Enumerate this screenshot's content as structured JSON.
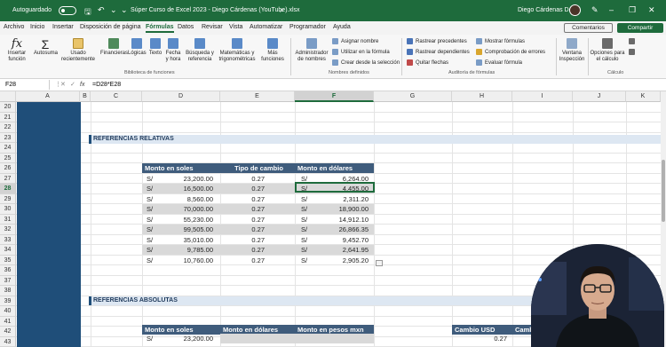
{
  "titlebar": {
    "autosave_label": "Autoguardado",
    "doc_title": "Súper Curso de Excel 2023 - Diego Cárdenas (YouTube).xlsx",
    "user_name": "Diego Cárdenas Dev"
  },
  "menu": {
    "items": [
      "Archivo",
      "Inicio",
      "Insertar",
      "Disposición de página",
      "Fórmulas",
      "Datos",
      "Revisar",
      "Vista",
      "Automatizar",
      "Programador",
      "Ayuda"
    ],
    "active": "Fórmulas",
    "comments_label": "Comentarios",
    "share_label": "Compartir"
  },
  "ribbon": {
    "insert_function": "Insertar función",
    "autosum": "Autosuma",
    "recent": "Usado recientemente",
    "financial": "Financieras",
    "logical": "Lógicas",
    "text": "Texto",
    "datetime": "Fecha y hora",
    "lookup": "Búsqueda y referencia",
    "math": "Matemáticas y trigonométricas",
    "more": "Más funciones",
    "group_library": "Biblioteca de funciones",
    "name_manager": "Administrador de nombres",
    "define_name": "Asignar nombre",
    "use_in_formula": "Utilizar en la fórmula",
    "create_from_selection": "Crear desde la selección",
    "group_names": "Nombres definidos",
    "trace_precedents": "Rastrear precedentes",
    "trace_dependents": "Rastrear dependientes",
    "remove_arrows": "Quitar flechas",
    "show_formulas": "Mostrar fórmulas",
    "error_checking": "Comprobación de errores",
    "evaluate_formula": "Evaluar fórmula",
    "group_auditing": "Auditoría de fórmulas",
    "watch_window": "Ventana Inspección",
    "calc_options": "Opciones para el cálculo",
    "group_calc": "Cálculo"
  },
  "formula_bar": {
    "name_box": "F28",
    "fx": "fx",
    "formula": "=D28*E28"
  },
  "columns": [
    "A",
    "B",
    "C",
    "D",
    "E",
    "F",
    "G",
    "H",
    "I",
    "J",
    "K"
  ],
  "rows": [
    "20",
    "21",
    "22",
    "23",
    "24",
    "25",
    "26",
    "27",
    "28",
    "29",
    "30",
    "31",
    "32",
    "33",
    "34",
    "35",
    "36",
    "37",
    "38",
    "39",
    "40",
    "41",
    "42",
    "43"
  ],
  "relativas": {
    "title": "REFERENCIAS RELATIVAS",
    "headers": [
      "Monto en soles",
      "Tipo de cambio",
      "Monto en dólares"
    ],
    "rows": [
      {
        "cur": "S/",
        "amount": "23,200.00",
        "rate": "0.27",
        "cur2": "S/",
        "usd": "6,264.00"
      },
      {
        "cur": "S/",
        "amount": "16,500.00",
        "rate": "0.27",
        "cur2": "S/",
        "usd": "4,455.00"
      },
      {
        "cur": "S/",
        "amount": "8,560.00",
        "rate": "0.27",
        "cur2": "S/",
        "usd": "2,311.20"
      },
      {
        "cur": "S/",
        "amount": "70,000.00",
        "rate": "0.27",
        "cur2": "S/",
        "usd": "18,900.00"
      },
      {
        "cur": "S/",
        "amount": "55,230.00",
        "rate": "0.27",
        "cur2": "S/",
        "usd": "14,912.10"
      },
      {
        "cur": "S/",
        "amount": "99,505.00",
        "rate": "0.27",
        "cur2": "S/",
        "usd": "26,866.35"
      },
      {
        "cur": "S/",
        "amount": "35,010.00",
        "rate": "0.27",
        "cur2": "S/",
        "usd": "9,452.70"
      },
      {
        "cur": "S/",
        "amount": "9,785.00",
        "rate": "0.27",
        "cur2": "S/",
        "usd": "2,641.95"
      },
      {
        "cur": "S/",
        "amount": "10,760.00",
        "rate": "0.27",
        "cur2": "S/",
        "usd": "2,905.20"
      }
    ]
  },
  "absolutas": {
    "title": "REFERENCIAS ABSOLUTAS",
    "headers": [
      "Monto en soles",
      "Monto en dólares",
      "Monto en pesos mxn"
    ],
    "first_row": {
      "cur": "S/",
      "amount": "23,200.00"
    },
    "side_headers": [
      "Cambio USD",
      "Camb"
    ],
    "side_value": "0.27"
  },
  "colors": {
    "excel_green": "#1e6b3c",
    "dark_blue": "#1f4e79",
    "header_blue": "#3f5c7c",
    "section_fill": "#dde7f2"
  }
}
